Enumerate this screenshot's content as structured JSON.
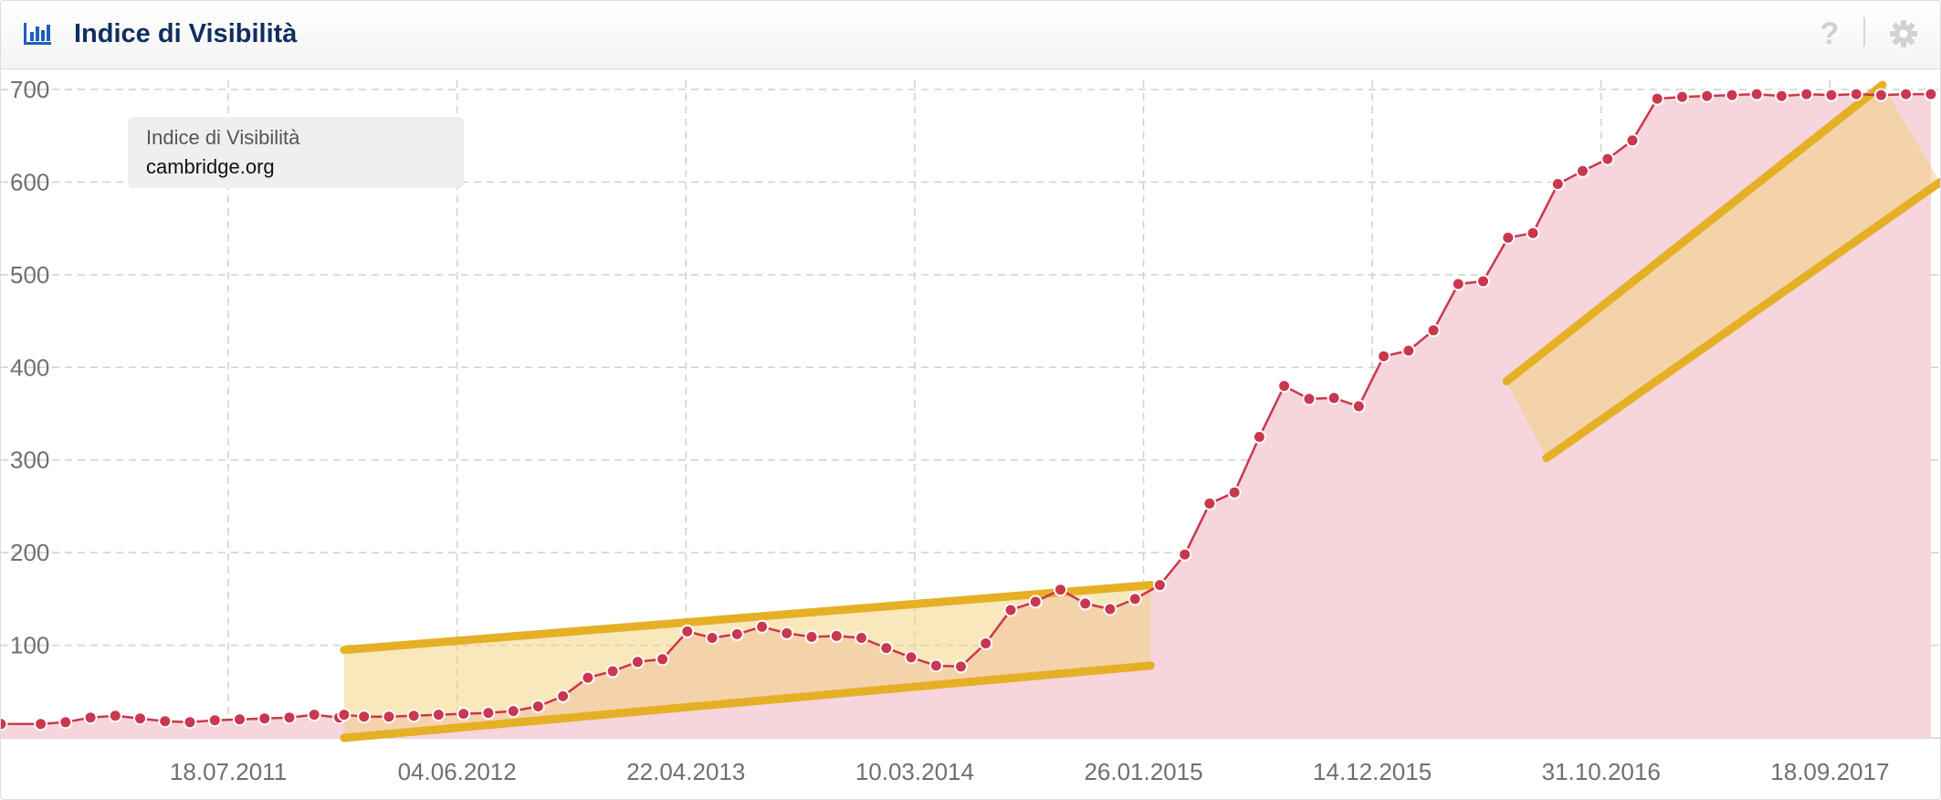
{
  "header": {
    "title": "Indice di Visibilità",
    "help_symbol": "?",
    "icons": [
      "bar-chart-icon",
      "help-icon",
      "gear-icon"
    ]
  },
  "tooltip": {
    "label": "Indice di Visibilità",
    "domain": "cambridge.org"
  },
  "colors": {
    "line": "#c9384e",
    "area": "#f6d5dc",
    "marker": "#c9384e",
    "channel": "#e5b026",
    "channel_fill": "#f2d27a",
    "grid": "#d0d0d0",
    "title": "#0f2f5f"
  },
  "chart_data": {
    "type": "area",
    "title": "",
    "xlabel": "",
    "ylabel": "",
    "ylim": [
      0,
      700
    ],
    "yticks": [
      100,
      200,
      300,
      400,
      500,
      600,
      700
    ],
    "xlim": [
      "2010-09-01",
      "2018-02-20"
    ],
    "xticks": [
      "18.07.2011",
      "04.06.2012",
      "22.04.2013",
      "10.03.2014",
      "26.01.2015",
      "14.12.2015",
      "31.10.2016",
      "18.09.2017"
    ],
    "grid": true,
    "series": [
      {
        "values": [
          [
            "2010-09-01",
            15
          ],
          [
            "2010-10-27",
            15
          ],
          [
            "2010-12-01",
            17
          ],
          [
            "2011-01-05",
            22
          ],
          [
            "2011-02-09",
            24
          ],
          [
            "2011-03-16",
            21
          ],
          [
            "2011-04-20",
            18
          ],
          [
            "2011-05-25",
            17
          ],
          [
            "2011-06-29",
            19
          ],
          [
            "2011-08-03",
            20
          ],
          [
            "2011-09-07",
            21
          ],
          [
            "2011-10-12",
            22
          ],
          [
            "2011-11-16",
            25
          ],
          [
            "2011-12-21",
            22
          ],
          [
            "2011-12-28",
            25
          ],
          [
            "2012-01-25",
            23
          ],
          [
            "2012-02-29",
            23
          ],
          [
            "2012-04-04",
            24
          ],
          [
            "2012-05-09",
            25
          ],
          [
            "2012-06-13",
            26
          ],
          [
            "2012-07-18",
            27
          ],
          [
            "2012-08-22",
            29
          ],
          [
            "2012-09-26",
            34
          ],
          [
            "2012-10-31",
            45
          ],
          [
            "2012-12-05",
            65
          ],
          [
            "2013-01-09",
            72
          ],
          [
            "2013-02-13",
            82
          ],
          [
            "2013-03-20",
            85
          ],
          [
            "2013-04-24",
            115
          ],
          [
            "2013-05-29",
            108
          ],
          [
            "2013-07-03",
            112
          ],
          [
            "2013-08-07",
            120
          ],
          [
            "2013-09-11",
            113
          ],
          [
            "2013-10-16",
            109
          ],
          [
            "2013-11-20",
            110
          ],
          [
            "2013-12-25",
            108
          ],
          [
            "2014-01-29",
            97
          ],
          [
            "2014-03-05",
            87
          ],
          [
            "2014-04-09",
            78
          ],
          [
            "2014-05-14",
            77
          ],
          [
            "2014-06-18",
            102
          ],
          [
            "2014-07-23",
            138
          ],
          [
            "2014-08-27",
            147
          ],
          [
            "2014-10-01",
            160
          ],
          [
            "2014-11-05",
            145
          ],
          [
            "2014-12-10",
            139
          ],
          [
            "2015-01-14",
            150
          ],
          [
            "2015-02-18",
            165
          ],
          [
            "2015-03-25",
            198
          ],
          [
            "2015-04-29",
            253
          ],
          [
            "2015-06-03",
            265
          ],
          [
            "2015-07-08",
            325
          ],
          [
            "2015-08-12",
            380
          ],
          [
            "2015-09-16",
            366
          ],
          [
            "2015-10-21",
            367
          ],
          [
            "2015-11-25",
            358
          ],
          [
            "2015-12-30",
            412
          ],
          [
            "2016-02-03",
            418
          ],
          [
            "2016-03-09",
            440
          ],
          [
            "2016-04-13",
            490
          ],
          [
            "2016-05-18",
            493
          ],
          [
            "2016-06-22",
            540
          ],
          [
            "2016-07-27",
            545
          ],
          [
            "2016-08-31",
            598
          ],
          [
            "2016-10-05",
            612
          ],
          [
            "2016-11-09",
            625
          ],
          [
            "2016-12-14",
            645
          ],
          [
            "2017-01-18",
            690
          ],
          [
            "2017-02-22",
            692
          ],
          [
            "2017-03-29",
            693
          ],
          [
            "2017-05-03",
            694
          ],
          [
            "2017-06-07",
            695
          ],
          [
            "2017-07-12",
            693
          ],
          [
            "2017-08-16",
            695
          ],
          [
            "2017-09-20",
            694
          ],
          [
            "2017-10-25",
            695
          ],
          [
            "2017-11-29",
            694
          ],
          [
            "2018-01-03",
            695
          ],
          [
            "2018-02-07",
            695
          ]
        ]
      }
    ]
  }
}
